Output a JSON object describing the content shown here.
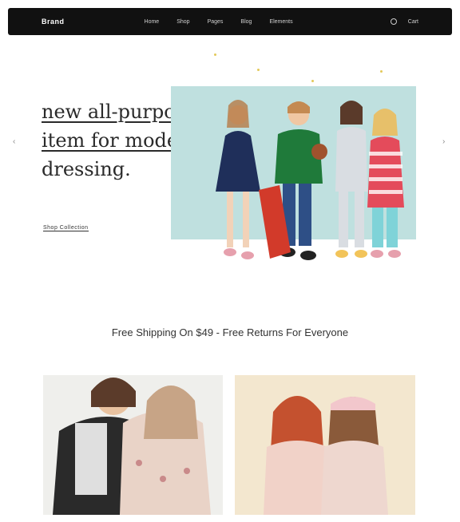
{
  "header": {
    "logo": "Brand",
    "nav": [
      "Home",
      "Shop",
      "Pages",
      "Blog",
      "Elements"
    ],
    "right": [
      "Cart"
    ]
  },
  "hero": {
    "eyebrow": "",
    "title_lines": [
      "new all-purpose",
      "item for modern",
      "dressing."
    ],
    "link": "Shop Collection",
    "prev": "‹",
    "next": "›"
  },
  "shipping": {
    "eyebrow": "",
    "title": "Free Shipping On $49 - Free Returns For Everyone",
    "subtitle": ""
  },
  "colors": {
    "topbar": "#111111",
    "hero_bg": "#bfe0df",
    "card_left_bg": "#f0f0ee",
    "card_right_bg": "#f1e6cf"
  }
}
